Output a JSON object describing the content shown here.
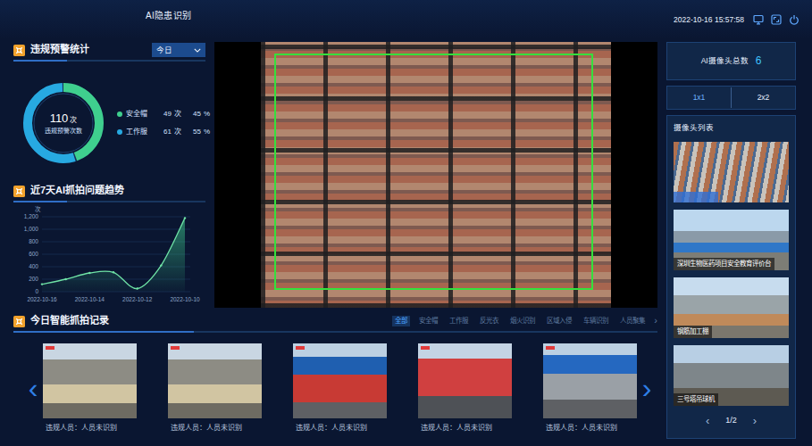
{
  "header": {
    "title": "AI隐患识别",
    "datetime": "2022-10-16 15:57:58"
  },
  "stats": {
    "title": "违规预警统计",
    "period": "今日",
    "total": "110",
    "total_unit": "次",
    "total_label": "违规预警次数",
    "items": [
      {
        "name": "安全帽",
        "count": "49",
        "unit": "次",
        "percent": "45",
        "percent_unit": "%",
        "level": 0.45,
        "color": "#3fcf8e"
      },
      {
        "name": "工作服",
        "count": "61",
        "unit": "次",
        "percent": "55",
        "percent_unit": "%",
        "level": 0.55,
        "color": "#27a9e1"
      }
    ]
  },
  "trend": {
    "title": "近7天AI抓拍问题趋势",
    "unit": "次",
    "axis_max": 1200,
    "y_ticks": [
      "0",
      "200",
      "400",
      "600",
      "800",
      "1,000",
      "1,200"
    ],
    "x_labels": [
      "2022-10-16",
      "2022-10-14",
      "2022-10-12",
      "2022-10-10"
    ],
    "series": [
      {
        "values": [
          120,
          200,
          300,
          310,
          50,
          420,
          1180
        ]
      }
    ]
  },
  "camera": {
    "label": "AI摄像头总数",
    "count": "6"
  },
  "views": [
    {
      "label": "1x1",
      "selected": true
    },
    {
      "label": "2x2",
      "selected": false
    }
  ],
  "camera_list": {
    "title": "摄像头列表",
    "items": [
      {
        "selected": true
      },
      {
        "caption": "深圳生物医药项目安全教育评价台",
        "selected": false
      },
      {
        "caption": "钢筋加工棚",
        "selected": false
      },
      {
        "caption": "三号塔吊球机",
        "selected": false
      }
    ],
    "prev": "‹",
    "page": "1/2",
    "next": "›"
  },
  "captures": {
    "title": "今日智能抓拍记录",
    "filters": [
      {
        "label": "全部",
        "selected": true
      },
      {
        "label": "安全帽",
        "selected": false
      },
      {
        "label": "工作服",
        "selected": false
      },
      {
        "label": "反光衣",
        "selected": false
      },
      {
        "label": "烟火识别",
        "selected": false
      },
      {
        "label": "区域入侵",
        "selected": false
      },
      {
        "label": "车辆识别",
        "selected": false
      },
      {
        "label": "人员聚集",
        "selected": false
      }
    ],
    "more": "›",
    "prev": "‹",
    "next": "›",
    "records": [
      {
        "caption": "违规人员：人员未识别"
      },
      {
        "caption": "违规人员：人员未识别"
      },
      {
        "caption": "违规人员：人员未识别"
      },
      {
        "caption": "违规人员：人员未识别"
      },
      {
        "caption": "违规人员：人员未识别"
      }
    ]
  }
}
